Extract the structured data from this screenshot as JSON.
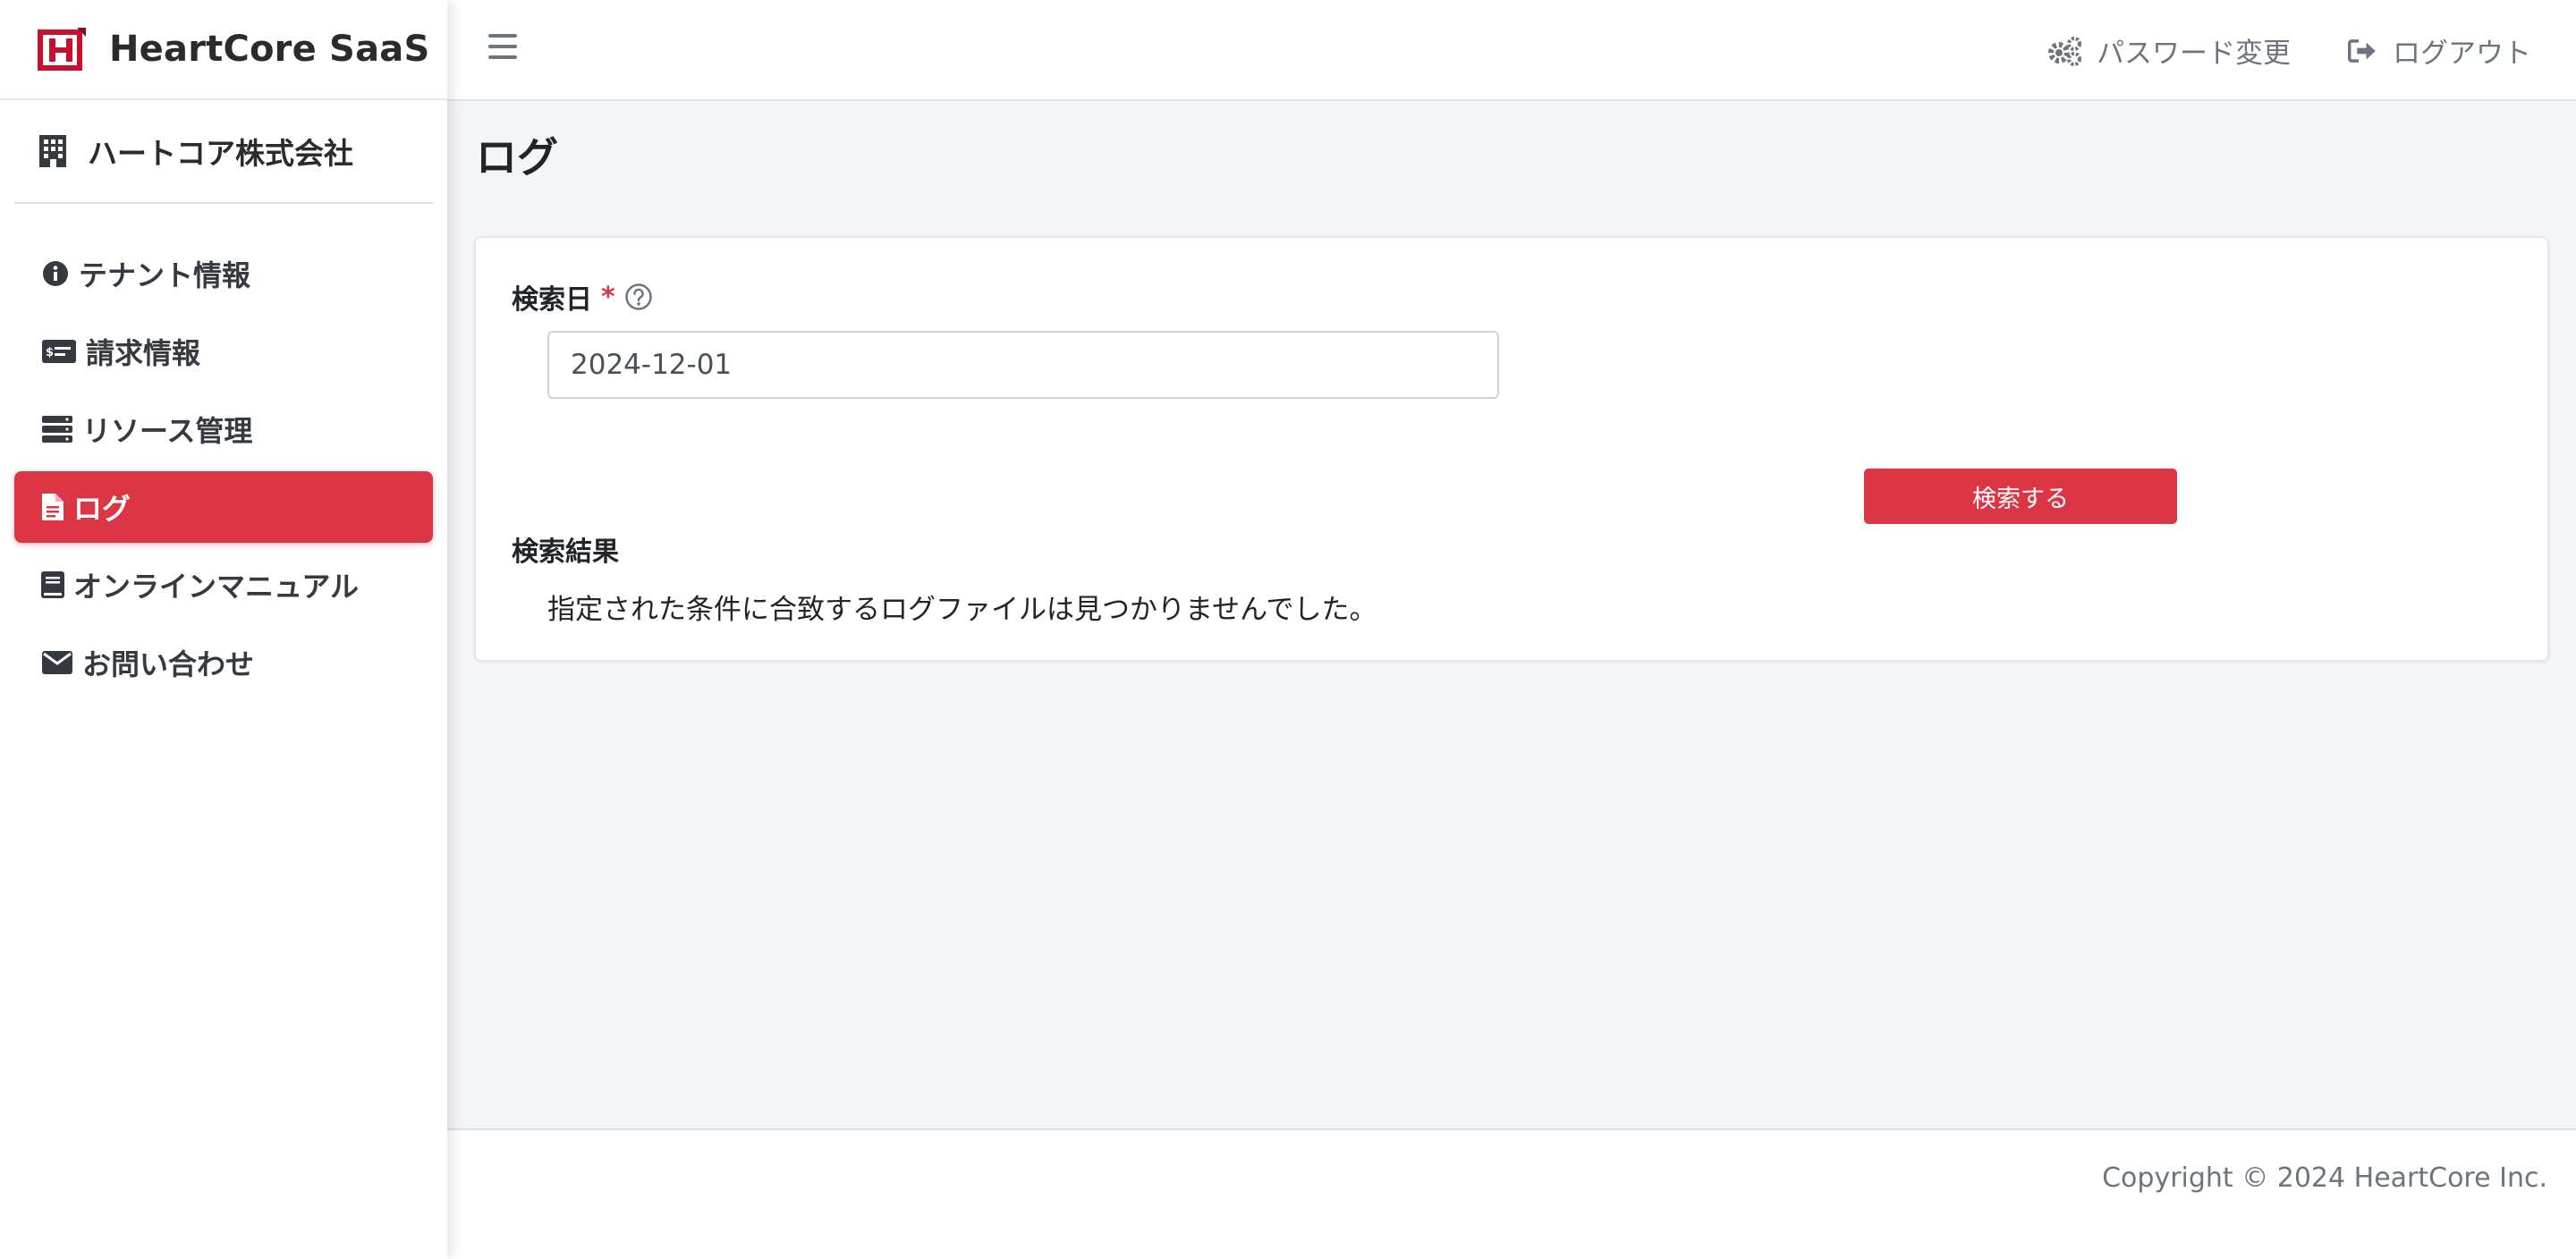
{
  "brand": {
    "name": "HeartCore SaaS",
    "logo_icon": "heartcore-logo-icon",
    "accent": "#dc3545"
  },
  "company": {
    "name": "ハートコア株式会社",
    "icon": "building-icon"
  },
  "sidebar": {
    "items": [
      {
        "label": "テナント情報",
        "icon": "info-circle-icon",
        "active": false
      },
      {
        "label": "請求情報",
        "icon": "money-bill-icon",
        "active": false
      },
      {
        "label": "リソース管理",
        "icon": "server-icon",
        "active": false
      },
      {
        "label": "ログ",
        "icon": "file-icon",
        "active": true
      },
      {
        "label": "オンラインマニュアル",
        "icon": "book-icon",
        "active": false
      },
      {
        "label": "お問い合わせ",
        "icon": "envelope-icon",
        "active": false
      }
    ]
  },
  "header": {
    "menu_icon": "hamburger-icon",
    "password_change": "パスワード変更",
    "logout": "ログアウト"
  },
  "main": {
    "title": "ログ",
    "search": {
      "label": "検索日",
      "required_mark": "*",
      "date_value": "2024-12-01",
      "button": "検索する"
    },
    "results": {
      "title": "検索結果",
      "message": "指定された条件に合致するログファイルは見つかりませんでした。"
    }
  },
  "footer": {
    "copyright": "Copyright © 2024 HeartCore Inc."
  }
}
